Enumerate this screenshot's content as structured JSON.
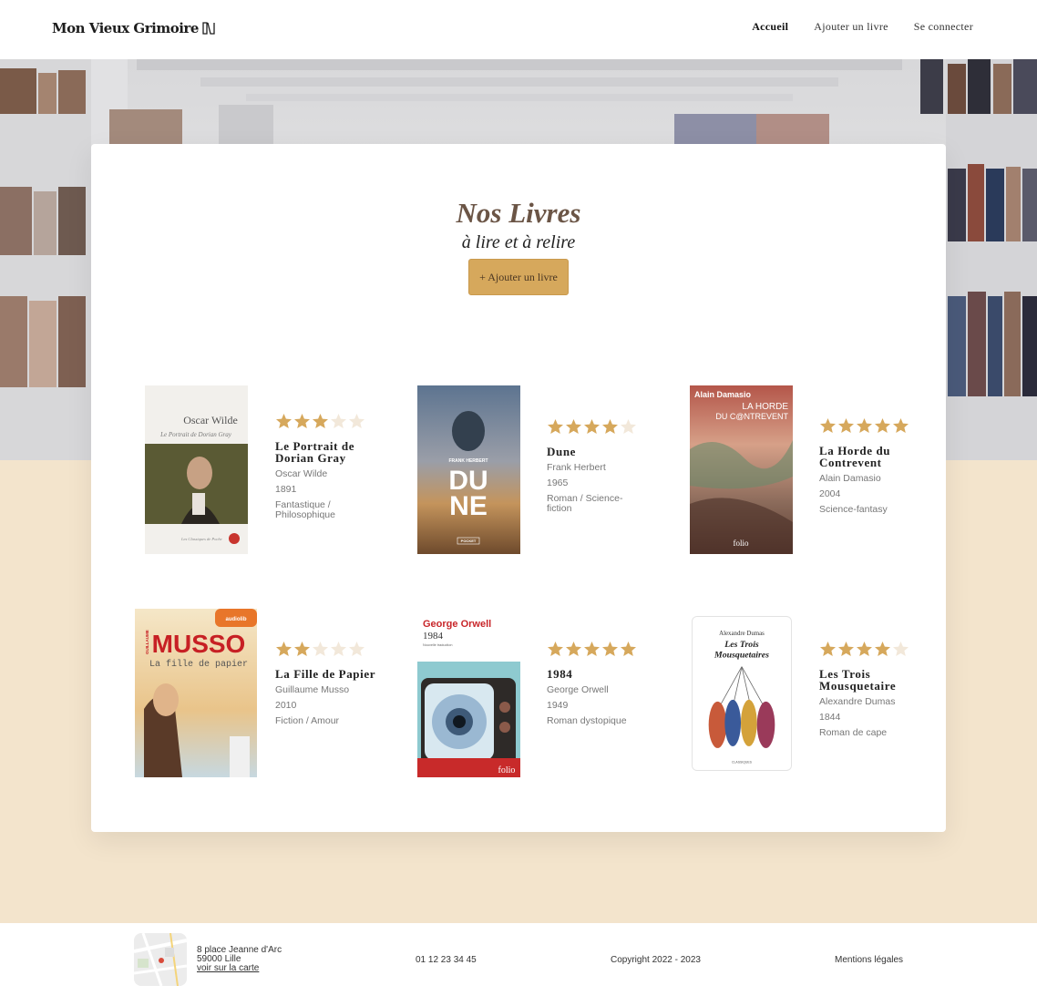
{
  "header": {
    "logo": "Mon Vieux Grimoire",
    "nav": [
      "Accueil",
      "Ajouter un livre",
      "Se connecter"
    ]
  },
  "main": {
    "title": "Nos Livres",
    "subtitle": "à lire et à relire",
    "add_button": "+ Ajouter un livre"
  },
  "books": [
    {
      "title": "Le Portrait de Dorian Gray",
      "author": "Oscar Wilde",
      "year": "1891",
      "genre": "Fantastique / Philosophique",
      "rating": 3,
      "cover": {
        "top": "Oscar Wilde",
        "sub": "Le Portrait de Dorian Gray",
        "bottom": "Les Classiques de Poche"
      }
    },
    {
      "title": "Dune",
      "author": "Frank Herbert",
      "year": "1965",
      "genre": "Roman / Science-fiction",
      "rating": 4,
      "cover": {
        "top": "FRANK HERBERT",
        "sub": "DU",
        "sub2": "NE",
        "bottom": "POCKET"
      }
    },
    {
      "title": "La Horde du Contrevent",
      "author": "Alain Damasio",
      "year": "2004",
      "genre": "Science-fantasy",
      "rating": 5,
      "cover": {
        "top": "Alain Damasio",
        "sub": "LA HORDE",
        "sub2": "DU C@NTREVENT",
        "bottom": "folio"
      }
    },
    {
      "title": "La Fille de Papier",
      "author": "Guillaume Musso",
      "year": "2010",
      "genre": "Fiction / Amour",
      "rating": 2,
      "cover": {
        "top": "MUSSO",
        "sub": "La fille de papier",
        "badge": "audiolib",
        "side": "GUILLAUME"
      }
    },
    {
      "title": "1984",
      "author": "George Orwell",
      "year": "1949",
      "genre": "Roman dystopique",
      "rating": 5,
      "cover": {
        "top": "George Orwell",
        "sub": "1984",
        "sub2": "Nouvelle traduction",
        "bottom": "folio"
      }
    },
    {
      "title": "Les Trois Mousquetaire",
      "author": "Alexandre Dumas",
      "year": "1844",
      "genre": "Roman de cape",
      "rating": 4,
      "cover": {
        "top": "Alexandre Dumas",
        "sub": "Les Trois",
        "sub2": "Mousquetaires",
        "bottom": "CLASSIQUES"
      }
    }
  ],
  "footer": {
    "address_line1": "8 place Jeanne d'Arc",
    "address_line2": "59000 Lille",
    "map_link": "voir sur la carte",
    "phone": "01 12 23 34 45",
    "copyright": "Copyright 2022 - 2023",
    "legal": "Mentions légales"
  },
  "colors": {
    "accent": "#d6a85c",
    "star_full": "#d6a85c",
    "star_empty": "#f2e8da",
    "title": "#6b5546",
    "background": "#f3e4cc"
  }
}
